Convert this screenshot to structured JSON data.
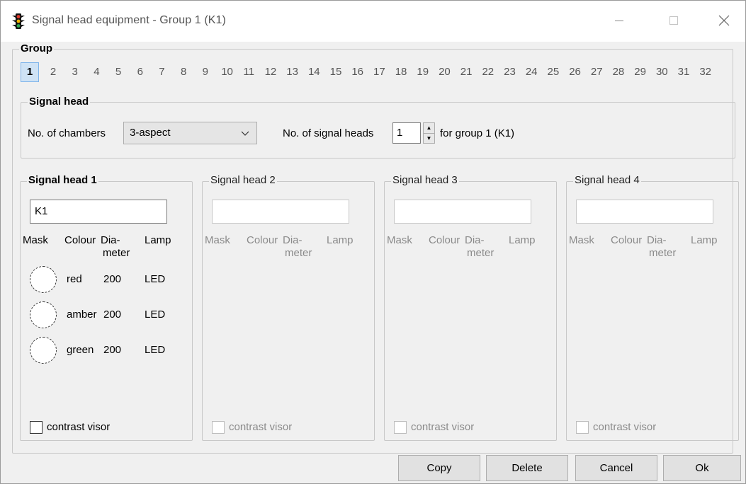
{
  "window": {
    "title": "Signal head equipment - Group 1 (K1)"
  },
  "group": {
    "label": "Group",
    "numbers": [
      "1",
      "2",
      "3",
      "4",
      "5",
      "6",
      "7",
      "8",
      "9",
      "10",
      "11",
      "12",
      "13",
      "14",
      "15",
      "16",
      "17",
      "18",
      "19",
      "20",
      "21",
      "22",
      "23",
      "24",
      "25",
      "26",
      "27",
      "28",
      "29",
      "30",
      "31",
      "32"
    ],
    "selected": "1"
  },
  "signal_head": {
    "label": "Signal head",
    "chambers_label": "No. of chambers",
    "chambers_value": "3-aspect",
    "count_label": "No. of signal heads",
    "count_value": "1",
    "for_group_label": "for group 1 (K1)"
  },
  "columns": {
    "mask": "Mask",
    "colour": "Colour",
    "diameter_line1": "Dia-",
    "diameter_line2": "meter",
    "lamp": "Lamp"
  },
  "heads": [
    {
      "title": "Signal head 1",
      "name": "K1",
      "rows": [
        {
          "colour": "red",
          "diameter": "200",
          "lamp": "LED"
        },
        {
          "colour": "amber",
          "diameter": "200",
          "lamp": "LED"
        },
        {
          "colour": "green",
          "diameter": "200",
          "lamp": "LED"
        }
      ],
      "contrast_visor": "contrast visor"
    },
    {
      "title": "Signal head 2",
      "name": "",
      "contrast_visor": "contrast visor"
    },
    {
      "title": "Signal head 3",
      "name": "",
      "contrast_visor": "contrast visor"
    },
    {
      "title": "Signal head 4",
      "name": "",
      "contrast_visor": "contrast visor"
    }
  ],
  "buttons": {
    "copy": "Copy",
    "delete": "Delete",
    "cancel": "Cancel",
    "ok": "Ok"
  }
}
